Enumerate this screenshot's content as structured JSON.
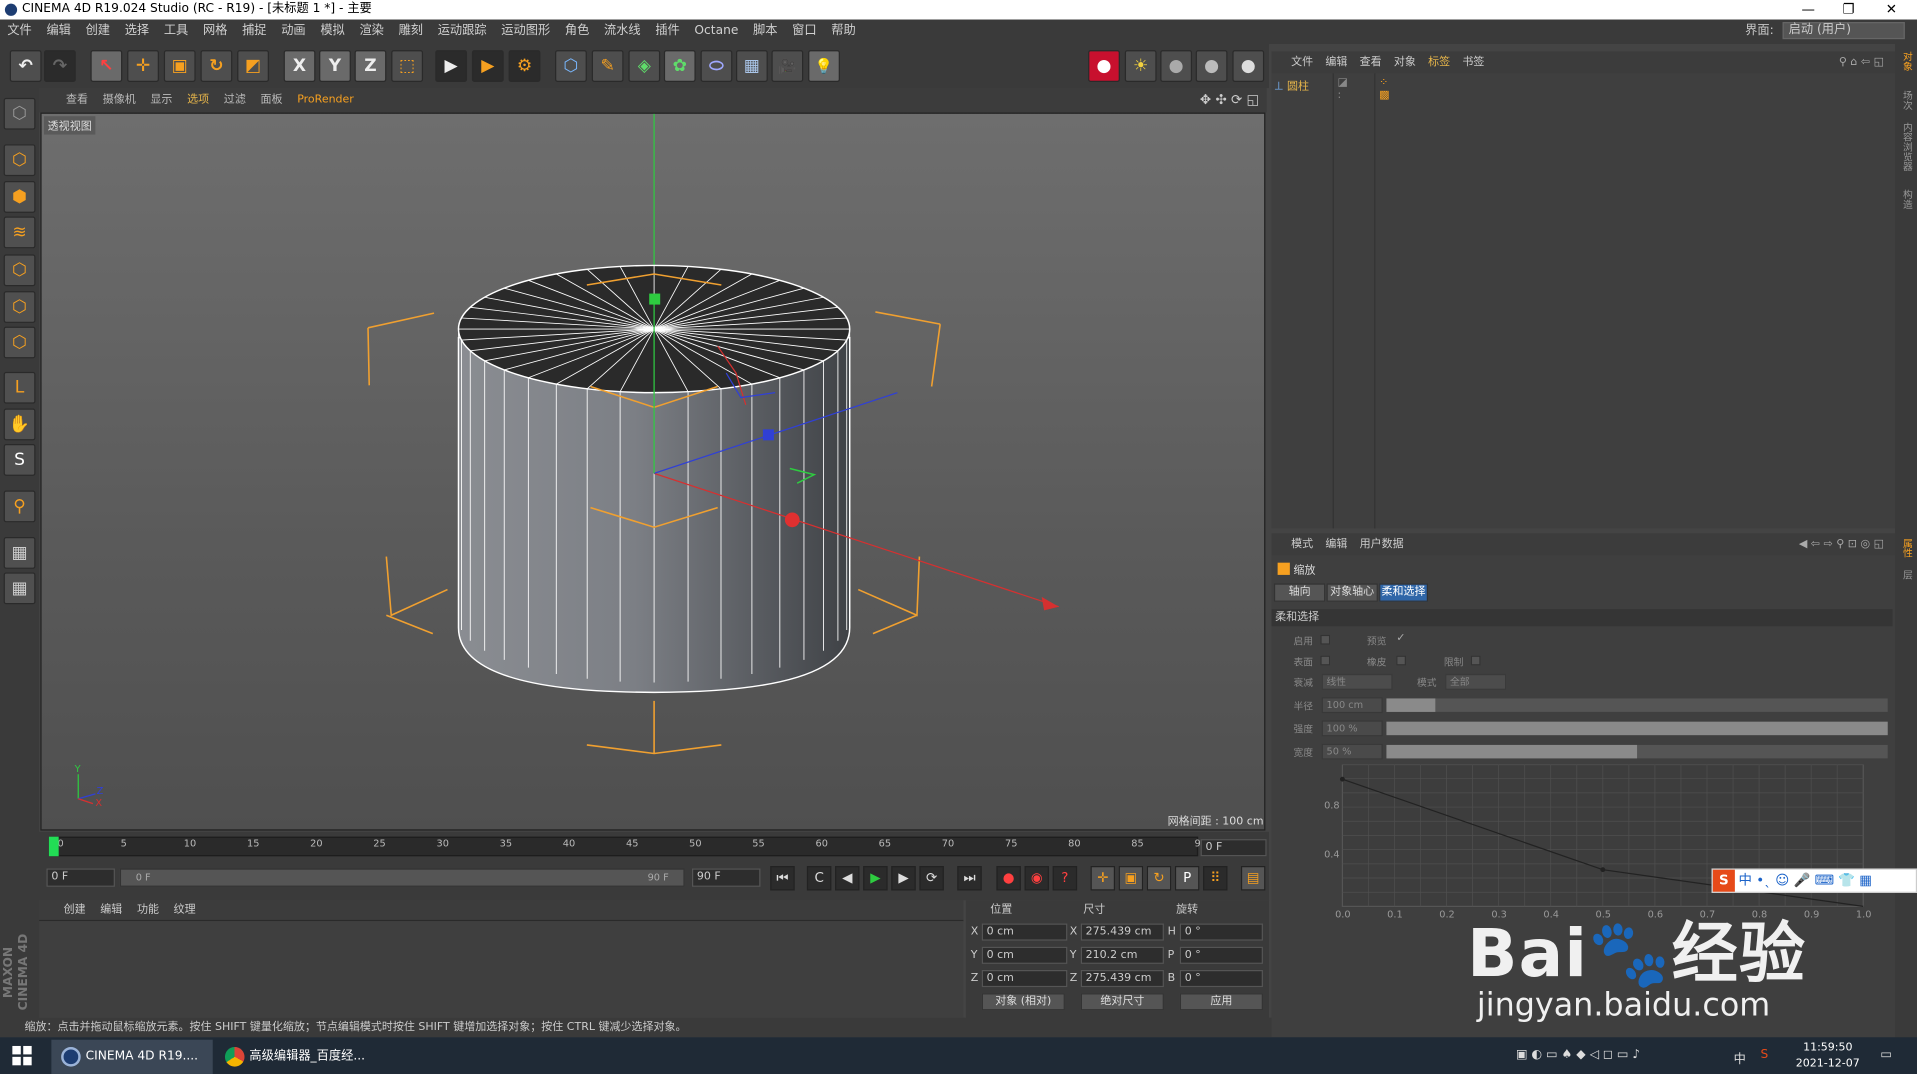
{
  "window": {
    "title": "CINEMA 4D R19.024 Studio (RC - R19) - [未标题 1 *] - 主要",
    "min": "—",
    "max": "❐",
    "close": "✕"
  },
  "menubar": {
    "items": [
      "文件",
      "编辑",
      "创建",
      "选择",
      "工具",
      "网格",
      "捕捉",
      "动画",
      "模拟",
      "渲染",
      "雕刻",
      "运动跟踪",
      "运动图形",
      "角色",
      "流水线",
      "插件",
      "Octane",
      "脚本",
      "窗口",
      "帮助"
    ],
    "layout_label": "界面:",
    "layout_value": "启动 (用户)"
  },
  "toolbar": {
    "undo": "↶",
    "redo": "↷",
    "select": "↖",
    "move": "✛",
    "scale": "▣",
    "rotate": "↻",
    "last": "◩",
    "x": "X",
    "y": "Y",
    "z": "Z",
    "coord": "⬚",
    "render_view": "▶",
    "render_pv": "▶",
    "render_settings": "⚙",
    "cube": "⬡",
    "pen": "✎",
    "subdiv": "◈",
    "cloner": "✿",
    "deformer": "⬭",
    "floor": "▦",
    "camera": "🎥",
    "light": "💡",
    "rec": "●",
    "sun": "☀",
    "sphere1": "●",
    "sphere2": "●",
    "sphere3": "●"
  },
  "left_tools": [
    "⬡",
    "⬢",
    "≋",
    "⬡",
    "⬡",
    "⬡",
    "L",
    "✋",
    "S",
    "⚲",
    "▦",
    "▦"
  ],
  "maxon_logo": "MAXON CINEMA 4D",
  "viewport": {
    "menu": [
      "查看",
      "摄像机",
      "显示",
      "选项",
      "过滤",
      "面板",
      "ProRender"
    ],
    "active": "选项",
    "label": "透视视图",
    "grid_distance": "网格间距 : 100 cm",
    "axis_x": "X",
    "axis_y": "Y",
    "axis_z": "Z"
  },
  "timeline": {
    "ticks": [
      "0",
      "5",
      "10",
      "15",
      "20",
      "25",
      "30",
      "35",
      "40",
      "45",
      "50",
      "55",
      "60",
      "65",
      "70",
      "75",
      "80",
      "85",
      "90"
    ],
    "frame_end": "0 F",
    "start": "0 F",
    "range_start": "0 F",
    "range_end": "90 F",
    "end": "90 F",
    "play": {
      "first": "⏮",
      "prev_key": "C",
      "prev": "◀",
      "play": "▶",
      "next": "▶",
      "next_key": "⟳",
      "last": "⏭",
      "rec": "●",
      "auto": "◉",
      "help": "?",
      "move": "✛",
      "scale": "▣",
      "rotate": "↻",
      "param": "P",
      "pla": "⠿",
      "anim": "▤"
    }
  },
  "material": {
    "menu": [
      "创建",
      "编辑",
      "功能",
      "纹理"
    ]
  },
  "coords": {
    "head_pos": "位置",
    "head_size": "尺寸",
    "head_rot": "旋转",
    "rows": [
      {
        "a": "X",
        "pos": "0 cm",
        "b": "X",
        "size": "275.439 cm",
        "c": "H",
        "rot": "0 °"
      },
      {
        "a": "Y",
        "pos": "0 cm",
        "b": "Y",
        "size": "210.2 cm",
        "c": "P",
        "rot": "0 °"
      },
      {
        "a": "Z",
        "pos": "0 cm",
        "b": "Z",
        "size": "275.439 cm",
        "c": "B",
        "rot": "0 °"
      }
    ],
    "mode": "对象 (相对)",
    "size_mode": "绝对尺寸",
    "apply": "应用"
  },
  "status": "缩放：点击并拖动鼠标缩放元素。按住 SHIFT 键量化缩放；节点编辑模式时按住 SHIFT 键增加选择对象；按住 CTRL 键减少选择对象。",
  "object_manager": {
    "menu": [
      "文件",
      "编辑",
      "查看",
      "对象",
      "标签",
      "书签"
    ],
    "active": "标签",
    "object": "圆柱"
  },
  "attr_manager": {
    "menu": [
      "模式",
      "编辑",
      "用户数据"
    ],
    "title": "缩放",
    "tabs": [
      "轴向",
      "对象轴心",
      "柔和选择"
    ],
    "active_tab": "柔和选择",
    "section": "柔和选择",
    "enable": "启用",
    "preview": "预览",
    "surface": "表面",
    "rubber": "橡皮",
    "restrict": "限制",
    "falloff": "衰减",
    "falloff_val": "线性",
    "mode": "模式",
    "mode_val": "全部",
    "radius": "半径",
    "radius_val": "100 cm",
    "strength": "强度",
    "strength_val": "100 %",
    "width": "宽度",
    "width_val": "50 %",
    "curve_y": [
      "0.8",
      "0.4"
    ],
    "curve_x": [
      "0.0",
      "0.1",
      "0.2",
      "0.3",
      "0.4",
      "0.5",
      "0.6",
      "0.7",
      "0.8",
      "0.9",
      "1.0"
    ]
  },
  "right_tabs": [
    "对象",
    "场次",
    "内容浏览器",
    "构造",
    "属性",
    "层"
  ],
  "ime": {
    "logo": "S",
    "text": "中 •ˎ ☺ 🎤 ⌨ 👕 ▦"
  },
  "taskbar": {
    "app1": "CINEMA 4D R19....",
    "app2": "高级编辑器_百度经...",
    "time": "11:59:50",
    "date": "2021-12-07",
    "lang": "中"
  },
  "watermark": {
    "text": "Bai🐾经验",
    "url": "jingyan.baidu.com"
  }
}
